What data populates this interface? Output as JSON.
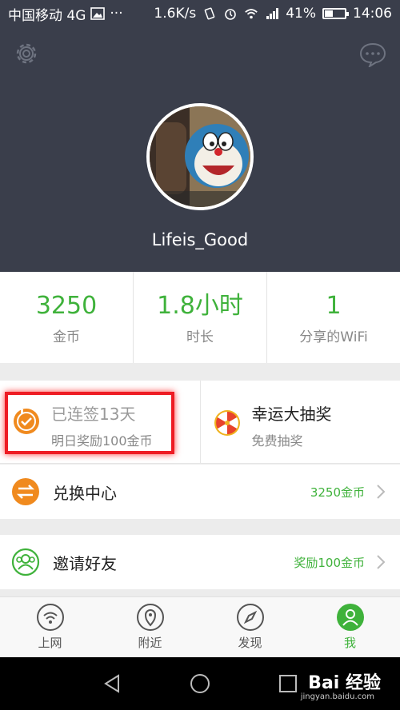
{
  "status_bar": {
    "carrier": "中国移动 4G",
    "dots": "···",
    "speed": "1.6K/s",
    "battery": "41%",
    "battery_level": 0.41,
    "time": "14:06"
  },
  "profile": {
    "username": "Lifeis_Good"
  },
  "stats": [
    {
      "value": "3250",
      "label": "金币"
    },
    {
      "value": "1.8小时",
      "label": "时长"
    },
    {
      "value": "1",
      "label": "分享的WiFi"
    }
  ],
  "checkin": {
    "title": "已连签13天",
    "subtitle": "明日奖励100金币"
  },
  "lottery": {
    "title": "幸运大抽奖",
    "subtitle": "免费抽奖"
  },
  "exchange": {
    "title": "兑换中心",
    "value": "3250金币"
  },
  "invite": {
    "title": "邀请好友",
    "value": "奖励100金币"
  },
  "nav": [
    {
      "label": "上网"
    },
    {
      "label": "附近"
    },
    {
      "label": "发现"
    },
    {
      "label": "我"
    }
  ],
  "watermark": {
    "brand": "Bai 经验",
    "url": "jingyan.baidu.com"
  },
  "colors": {
    "header_bg": "#3a3e4b",
    "accent_green": "#3fb23b",
    "accent_orange": "#f08a1e",
    "highlight_red": "#ee1c24"
  }
}
